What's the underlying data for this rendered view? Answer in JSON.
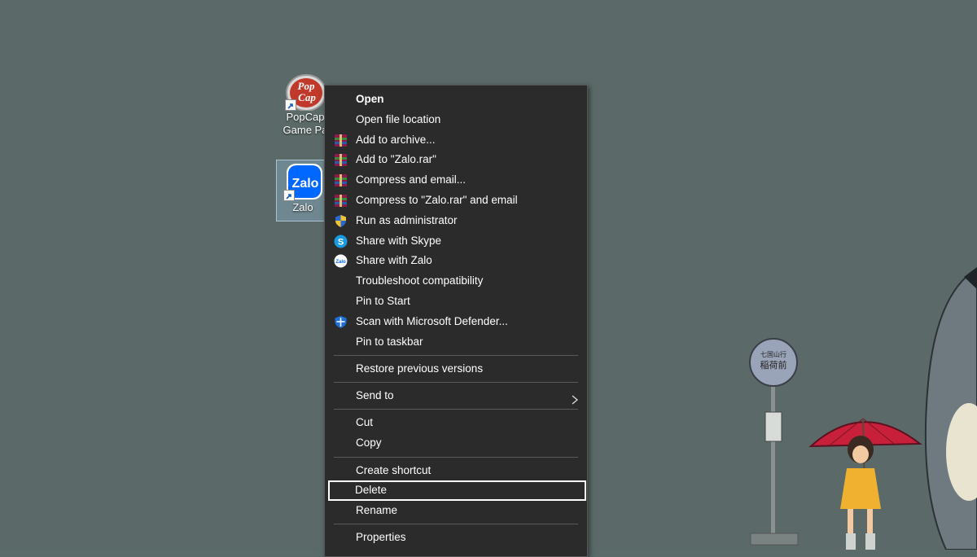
{
  "desktop": {
    "icons": [
      {
        "label_line1": "PopCap",
        "label_line2": "Game Pa",
        "logo_top": "Pop",
        "logo_bottom": "Cap"
      },
      {
        "label_line1": "Zalo",
        "logo_text": "Zalo"
      }
    ]
  },
  "context_menu": {
    "items": {
      "open": "Open",
      "open_file_location": "Open file location",
      "add_to_archive": "Add to archive...",
      "add_to_zalo_rar": "Add to \"Zalo.rar\"",
      "compress_and_email": "Compress and email...",
      "compress_to_zalo_rar_email": "Compress to \"Zalo.rar\" and email",
      "run_as_administrator": "Run as administrator",
      "share_with_skype": "Share with Skype",
      "share_with_zalo": "Share with Zalo",
      "troubleshoot_compatibility": "Troubleshoot compatibility",
      "pin_to_start": "Pin to Start",
      "scan_with_defender": "Scan with Microsoft Defender...",
      "pin_to_taskbar": "Pin to taskbar",
      "restore_previous_versions": "Restore previous versions",
      "send_to": "Send to",
      "cut": "Cut",
      "copy": "Copy",
      "create_shortcut": "Create shortcut",
      "delete": "Delete",
      "rename": "Rename",
      "properties": "Properties"
    },
    "focused_item": "Delete"
  },
  "wallpaper": {
    "sign_text_top": "七国山行",
    "sign_text_main": "稲荷前"
  },
  "colors": {
    "desktop_bg": "#5b6a68",
    "menu_bg": "#2b2b2b",
    "menu_text": "#ffffff",
    "separator": "#5a5a5a",
    "zalo_blue": "#0068ff",
    "umbrella_red": "#c8203a"
  }
}
